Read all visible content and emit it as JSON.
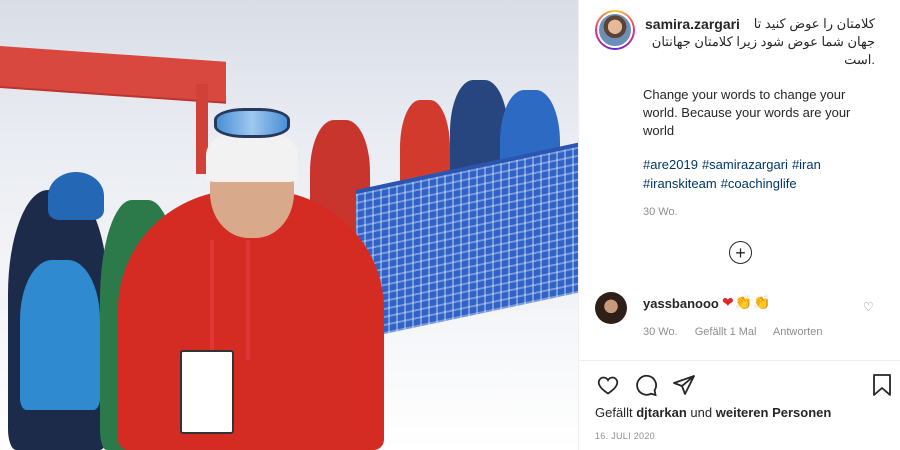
{
  "post": {
    "author": "samira.zargari",
    "caption_fa_line1": "کلامتان را عوض کنید تا",
    "caption_fa_line2": "جهان شما عوض شود زیرا کلامتان جهانتان",
    "caption_fa_line3": ".است",
    "caption_en": "Change your words to change your world. Because your words are your world",
    "hashtags": [
      "#are2019",
      "#samirazargari",
      "#iran",
      "#iranskiteam",
      "#coachinglife"
    ],
    "age": "30 Wo.",
    "load_more_icon": "plus-circle-icon"
  },
  "comment": {
    "username": "yassbanooo",
    "text": "❤👏👏",
    "age": "30 Wo.",
    "likes": "Gefällt 1 Mal",
    "reply_label": "Antworten"
  },
  "actions": {
    "icons": [
      "heart-icon",
      "comment-icon",
      "share-icon",
      "bookmark-icon"
    ]
  },
  "likes": {
    "prefix": "Gefällt",
    "user": "djtarkan",
    "middle": "und",
    "suffix": "weiteren Personen"
  },
  "date": "16. JULI 2020"
}
